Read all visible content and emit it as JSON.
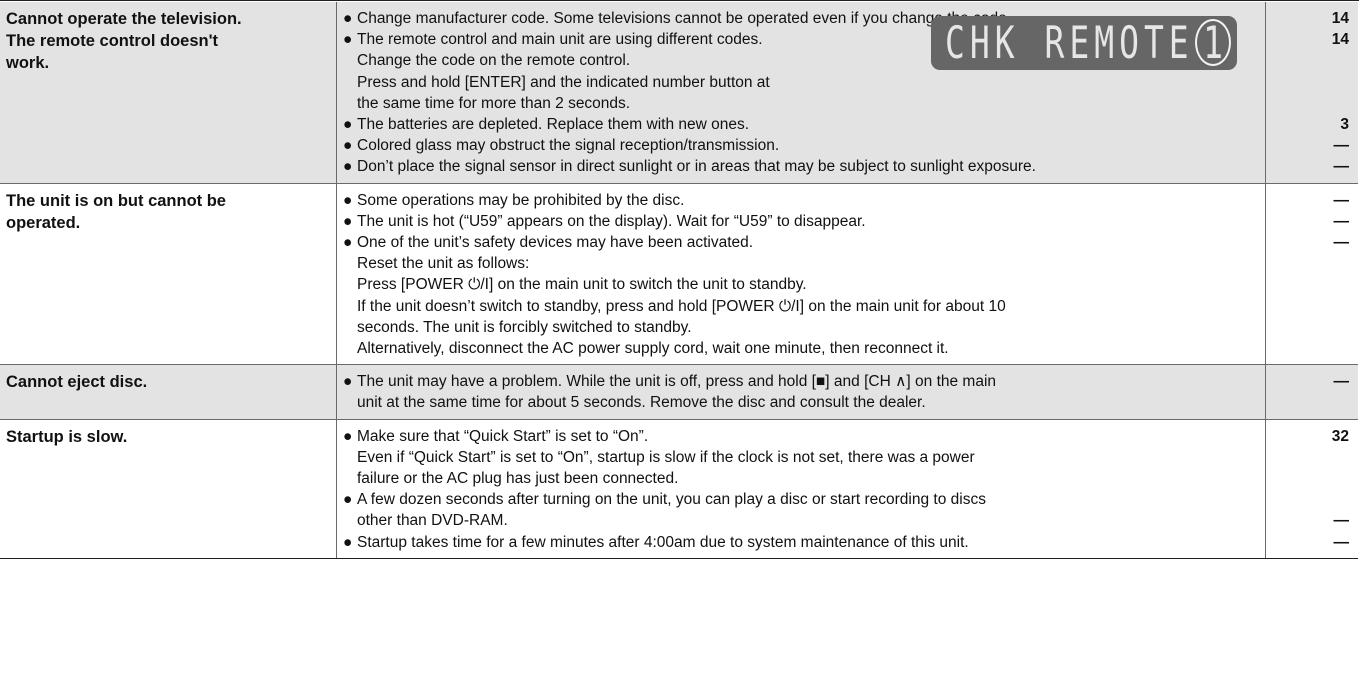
{
  "rows": [
    {
      "problem": "Cannot operate the television.\nThe remote control doesn't\nwork.",
      "shaded": true,
      "lines": [
        {
          "bullet": true,
          "text": "Change manufacturer code. Some televisions cannot be operated even if you change the code.",
          "page": "14"
        },
        {
          "bullet": true,
          "text": "The remote control and main unit are using different codes.",
          "page": "14"
        },
        {
          "bullet": false,
          "text": "Change the code on the remote control.",
          "page": ""
        },
        {
          "bullet": false,
          "text": "Press and hold [ENTER] and the indicated number button at",
          "page": ""
        },
        {
          "bullet": false,
          "text": "the same time for more than 2 seconds.",
          "page": ""
        },
        {
          "bullet": true,
          "text": "The batteries are depleted. Replace them with new ones.",
          "page": "3"
        },
        {
          "bullet": true,
          "text": "Colored glass may obstruct the signal reception/transmission.",
          "page": "—"
        },
        {
          "bullet": true,
          "text": "Don’t place the signal sensor in direct sunlight or in areas that may be subject to sunlight exposure.",
          "page": "—"
        }
      ],
      "display": {
        "text": "CHK REMOTE",
        "digit": "1"
      }
    },
    {
      "problem": "The unit is on but cannot be\noperated.",
      "shaded": false,
      "lines": [
        {
          "bullet": true,
          "text": "Some operations may be prohibited by the disc.",
          "page": "—"
        },
        {
          "bullet": true,
          "text": "The unit is hot (“U59” appears on the display). Wait for “U59” to disappear.",
          "page": "—"
        },
        {
          "bullet": true,
          "text": "One of the unit’s safety devices may have been activated.",
          "page": "—"
        },
        {
          "bullet": false,
          "text": "Reset the unit as follows:",
          "page": ""
        },
        {
          "bullet": false,
          "text": "Press [POWER ⏻/I] on the main unit to switch the unit to standby.",
          "page": ""
        },
        {
          "bullet": false,
          "text": "If the unit doesn’t switch to standby, press and hold [POWER ⏻/I] on the main unit for about 10",
          "page": ""
        },
        {
          "bullet": false,
          "text": "seconds. The unit is forcibly switched to standby.",
          "page": ""
        },
        {
          "bullet": false,
          "text": "Alternatively, disconnect the AC power supply cord, wait one minute, then reconnect it.",
          "page": ""
        }
      ]
    },
    {
      "problem": "Cannot eject disc.",
      "shaded": true,
      "lines": [
        {
          "bullet": true,
          "text": "The unit may have a problem. While the unit is off, press and hold [■] and [CH ∧] on the main",
          "page": "—"
        },
        {
          "bullet": false,
          "text": "unit at the same time for about 5 seconds. Remove the disc and consult the dealer.",
          "page": ""
        }
      ]
    },
    {
      "problem": "Startup is slow.",
      "shaded": false,
      "lines": [
        {
          "bullet": true,
          "text": "Make sure that “Quick Start” is set to “On”.",
          "page": "32"
        },
        {
          "bullet": false,
          "text": "Even if “Quick Start” is set to “On”, startup is slow if the clock is not set, there was a power",
          "page": ""
        },
        {
          "bullet": false,
          "text": "failure or the AC plug has just been connected.",
          "page": ""
        },
        {
          "bullet": true,
          "text": "A few dozen seconds after turning on the unit, you can play a disc or start recording to discs",
          "page": ""
        },
        {
          "bullet": false,
          "text": "other than DVD-RAM.",
          "page": "—"
        },
        {
          "bullet": true,
          "text": "Startup takes time for a few minutes after 4:00am due to system maintenance of this unit.",
          "page": "—"
        }
      ]
    }
  ],
  "bullet_glyph": "●"
}
